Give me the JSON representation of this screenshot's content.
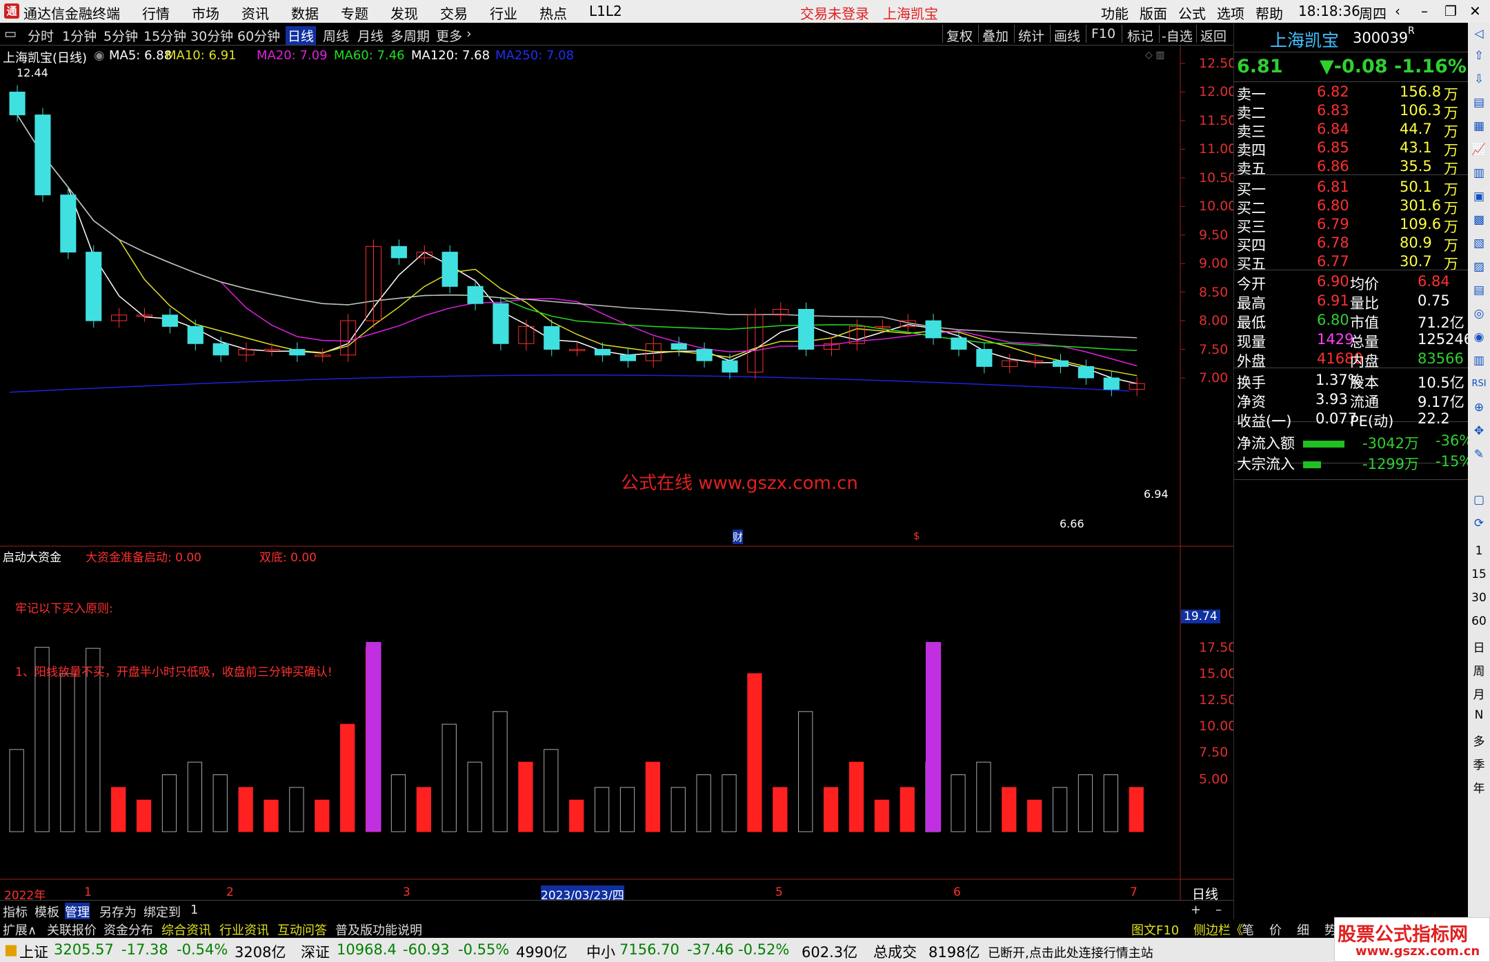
{
  "titlebar": {
    "app": "通达信金融终端",
    "menu": [
      "行情",
      "市场",
      "资讯",
      "数据",
      "专题",
      "发现",
      "交易",
      "行业",
      "热点",
      "L1L2"
    ],
    "trade_status": "交易未登录",
    "stock_name": "上海凯宝",
    "right_menu": [
      "功能",
      "版面",
      "公式",
      "选项",
      "帮助"
    ],
    "time": "18:18:36",
    "weekday": "周四"
  },
  "periods": [
    "分时",
    "1分钟",
    "5分钟",
    "15分钟",
    "30分钟",
    "60分钟",
    "日线",
    "周线",
    "月线",
    "多周期",
    "更多"
  ],
  "active_period": "日线",
  "toolbar_right": [
    "复权",
    "叠加",
    "统计",
    "画线",
    "F10",
    "标记",
    "-自选",
    "返回"
  ],
  "main_chart": {
    "header": {
      "name": "上海凯宝(日线)",
      "ma5": "MA5: 6.88",
      "ma10": "MA10: 6.91",
      "ma20": "MA20: 7.09",
      "ma60": "MA60: 7.46",
      "ma120": "MA120: 7.68",
      "ma250": "MA250: 7.08"
    },
    "high_label": "12.44",
    "low_label": "6.66",
    "last_label": "6.94",
    "yticks": [
      "12.50",
      "12.00",
      "11.50",
      "11.00",
      "10.50",
      "10.00",
      "9.50",
      "9.00",
      "8.50",
      "8.00",
      "7.50",
      "7.00"
    ],
    "watermark": "公式在线 www.gszx.com.cn",
    "markers": [
      "财",
      "$"
    ],
    "colors": {
      "up": "#ff3030",
      "down": "#40e0e0",
      "ma5": "#ffffff",
      "ma10": "#e0e020",
      "ma20": "#e020e0",
      "ma60": "#20e020",
      "ma120": "#c0c0c0",
      "ma250": "#2020e0"
    }
  },
  "chart_data": {
    "type": "line",
    "title": "上海凯宝(日线)",
    "ylim": [
      6.6,
      12.6
    ],
    "close_approx": [
      11.6,
      10.2,
      9.2,
      8.0,
      8.1,
      8.1,
      7.9,
      7.6,
      7.4,
      7.5,
      7.5,
      7.4,
      7.4,
      8.0,
      9.3,
      9.1,
      9.2,
      8.6,
      8.3,
      7.6,
      7.9,
      7.5,
      7.5,
      7.4,
      7.3,
      7.6,
      7.5,
      7.3,
      7.1,
      8.1,
      8.2,
      7.5,
      7.6,
      7.9,
      7.9,
      8.0,
      7.7,
      7.5,
      7.2,
      7.3,
      7.3,
      7.2,
      7.0,
      6.8,
      6.9
    ],
    "series": [
      {
        "name": "MA5",
        "last": 6.88
      },
      {
        "name": "MA10",
        "last": 6.91
      },
      {
        "name": "MA20",
        "last": 7.09
      },
      {
        "name": "MA60",
        "last": 7.46
      },
      {
        "name": "MA120",
        "last": 7.68
      },
      {
        "name": "MA250",
        "last": 7.08
      }
    ]
  },
  "sub_chart": {
    "header": {
      "name": "启动大资金",
      "s1": "大资金准备启动: 0.00",
      "s2": "双底: 0.00"
    },
    "note1": "牢记以下买入原则:",
    "note2": "1、阳线放量不买，开盘半小时只低吸，收盘前三分钟买确认!",
    "cur_label": "19.74",
    "yticks": [
      "17.50",
      "15.00",
      "12.50",
      "10.00",
      "7.50",
      "5.00"
    ]
  },
  "xaxis": {
    "labels": [
      "2022年",
      "1",
      "2",
      "3",
      "2023/03/23/四",
      "5",
      "6",
      "7"
    ],
    "period": "日线"
  },
  "quote": {
    "name": "上海凯宝",
    "code": "300039",
    "code_sup": "R",
    "price": "6.81",
    "change": "▼-0.08",
    "pct": "-1.16%",
    "asks": [
      {
        "l": "卖五",
        "p": "6.86",
        "v": "35.5",
        "u": "万"
      },
      {
        "l": "卖四",
        "p": "6.85",
        "v": "43.1",
        "u": "万"
      },
      {
        "l": "卖三",
        "p": "6.84",
        "v": "44.7",
        "u": "万"
      },
      {
        "l": "卖二",
        "p": "6.83",
        "v": "106.3",
        "u": "万"
      },
      {
        "l": "卖一",
        "p": "6.82",
        "v": "156.8",
        "u": "万"
      }
    ],
    "bids": [
      {
        "l": "买一",
        "p": "6.81",
        "v": "50.1",
        "u": "万"
      },
      {
        "l": "买二",
        "p": "6.80",
        "v": "301.6",
        "u": "万"
      },
      {
        "l": "买三",
        "p": "6.79",
        "v": "109.6",
        "u": "万"
      },
      {
        "l": "买四",
        "p": "6.78",
        "v": "80.9",
        "u": "万"
      },
      {
        "l": "买五",
        "p": "6.77",
        "v": "30.7",
        "u": "万"
      }
    ],
    "stats": [
      {
        "l1": "今开",
        "v1": "6.90",
        "l2": "均价",
        "v2": "6.84"
      },
      {
        "l1": "最高",
        "v1": "6.91",
        "l2": "量比",
        "v2": "0.75"
      },
      {
        "l1": "最低",
        "v1": "6.80",
        "l2": "市值",
        "v2": "71.2亿"
      },
      {
        "l1": "现量",
        "v1": "1429",
        "l2": "总量",
        "v2": "125246"
      },
      {
        "l1": "外盘",
        "v1": "41680",
        "l2": "内盘",
        "v2": "83566"
      }
    ],
    "stats2": [
      {
        "l1": "换手",
        "v1": "1.37%",
        "l2": "股本",
        "v2": "10.5亿"
      },
      {
        "l1": "净资",
        "v1": "3.93",
        "l2": "流通",
        "v2": "9.17亿"
      },
      {
        "l1": "收益(一)",
        "v1": "0.077",
        "l2": "PE(动)",
        "v2": "22.2"
      }
    ],
    "flow": [
      {
        "l": "净流入额",
        "v": "-3042万",
        "p": "-36%"
      },
      {
        "l": "大宗流入",
        "v": "-1299万",
        "p": "-15%"
      }
    ]
  },
  "sidebar_labels": [
    "1",
    "15",
    "30",
    "60",
    "日",
    "周",
    "月",
    "N",
    "多",
    "季",
    "年"
  ],
  "tabs": [
    "指标",
    "模板",
    "管理",
    "另存为",
    "绑定到",
    "1"
  ],
  "tabs2": [
    "扩展∧",
    "关联报价",
    "资金分布",
    "综合资讯",
    "行业资讯",
    "互动问答",
    "普及版功能说明"
  ],
  "tabs2_right": [
    "图文F10",
    "侧边栏《",
    "笔",
    "价",
    "细",
    "势"
  ],
  "status": {
    "sh": {
      "name": "上证",
      "v": "3205.57",
      "c": "-17.38",
      "p": "-0.54%",
      "a": "3208亿"
    },
    "sz": {
      "name": "深证",
      "v": "10968.4",
      "c": "-60.93",
      "p": "-0.55%",
      "a": "4990亿"
    },
    "zx": {
      "name": "中小",
      "v": "7156.70",
      "c": "-37.46",
      "p": "-0.52%",
      "a": "602.3亿"
    },
    "total_label": "总成交",
    "total": "8198亿",
    "msg": "已断开,点击此处连接行情主站",
    "brand": "股票公式指标网",
    "brand_url": "www.gszx.com.cn"
  }
}
